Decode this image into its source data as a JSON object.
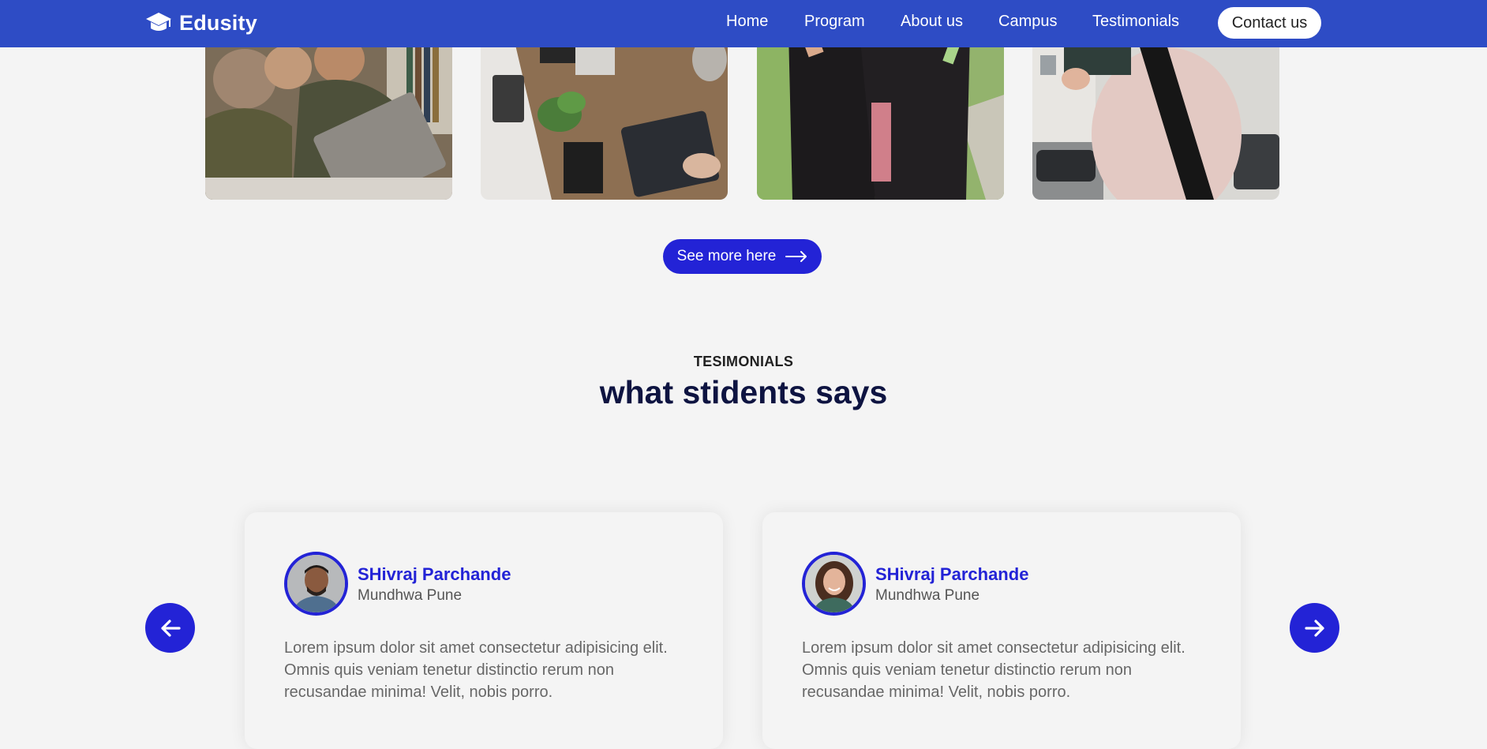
{
  "nav": {
    "logo_text": "Edusity",
    "links": [
      "Home",
      "Program",
      "About us",
      "Campus",
      "Testimonials"
    ],
    "contact_label": "Contact us"
  },
  "campus": {
    "see_more_label": "See more here"
  },
  "testimonials": {
    "tag": "TESIMONIALS",
    "title": "what stidents says",
    "cards": [
      {
        "name": "SHivraj Parchande",
        "location": "Mundhwa Pune",
        "quote": "Lorem ipsum dolor sit amet consectetur adipisicing elit. Omnis quis veniam tenetur distinctio rerum non recusandae minima! Velit, nobis porro."
      },
      {
        "name": "SHivraj Parchande",
        "location": "Mundhwa Pune",
        "quote": "Lorem ipsum dolor sit amet consectetur adipisicing elit. Omnis quis veniam tenetur distinctio rerum non recusandae minima! Velit, nobis porro."
      }
    ]
  },
  "icons": {
    "logo": "graduation-cap-icon",
    "see_more": "arrow-right-icon",
    "prev": "arrow-left-icon",
    "next": "arrow-right-icon"
  },
  "colors": {
    "nav_bg": "#2e4cc5",
    "accent": "#2323d6",
    "title": "#0e1441",
    "page_bg": "#f4f4f4"
  }
}
